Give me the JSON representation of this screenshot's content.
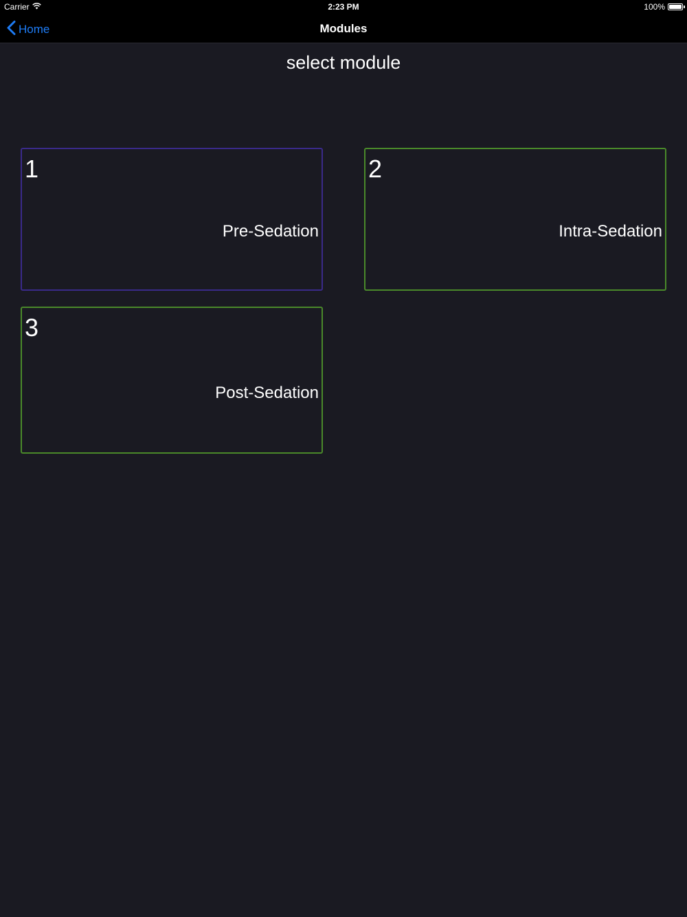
{
  "status_bar": {
    "carrier": "Carrier",
    "time": "2:23 PM",
    "battery": "100%"
  },
  "nav": {
    "back_label": "Home",
    "title": "Modules"
  },
  "page": {
    "heading": "select module"
  },
  "modules": [
    {
      "number": "1",
      "label": "Pre-Sedation",
      "border_color": "#3a2a8a"
    },
    {
      "number": "2",
      "label": "Intra-Sedation",
      "border_color": "#4a8a2a"
    },
    {
      "number": "3",
      "label": "Post-Sedation",
      "border_color": "#4a8a2a"
    }
  ],
  "colors": {
    "background": "#1a1a22",
    "bar_background": "#000000",
    "link_blue": "#1e7cf5"
  }
}
